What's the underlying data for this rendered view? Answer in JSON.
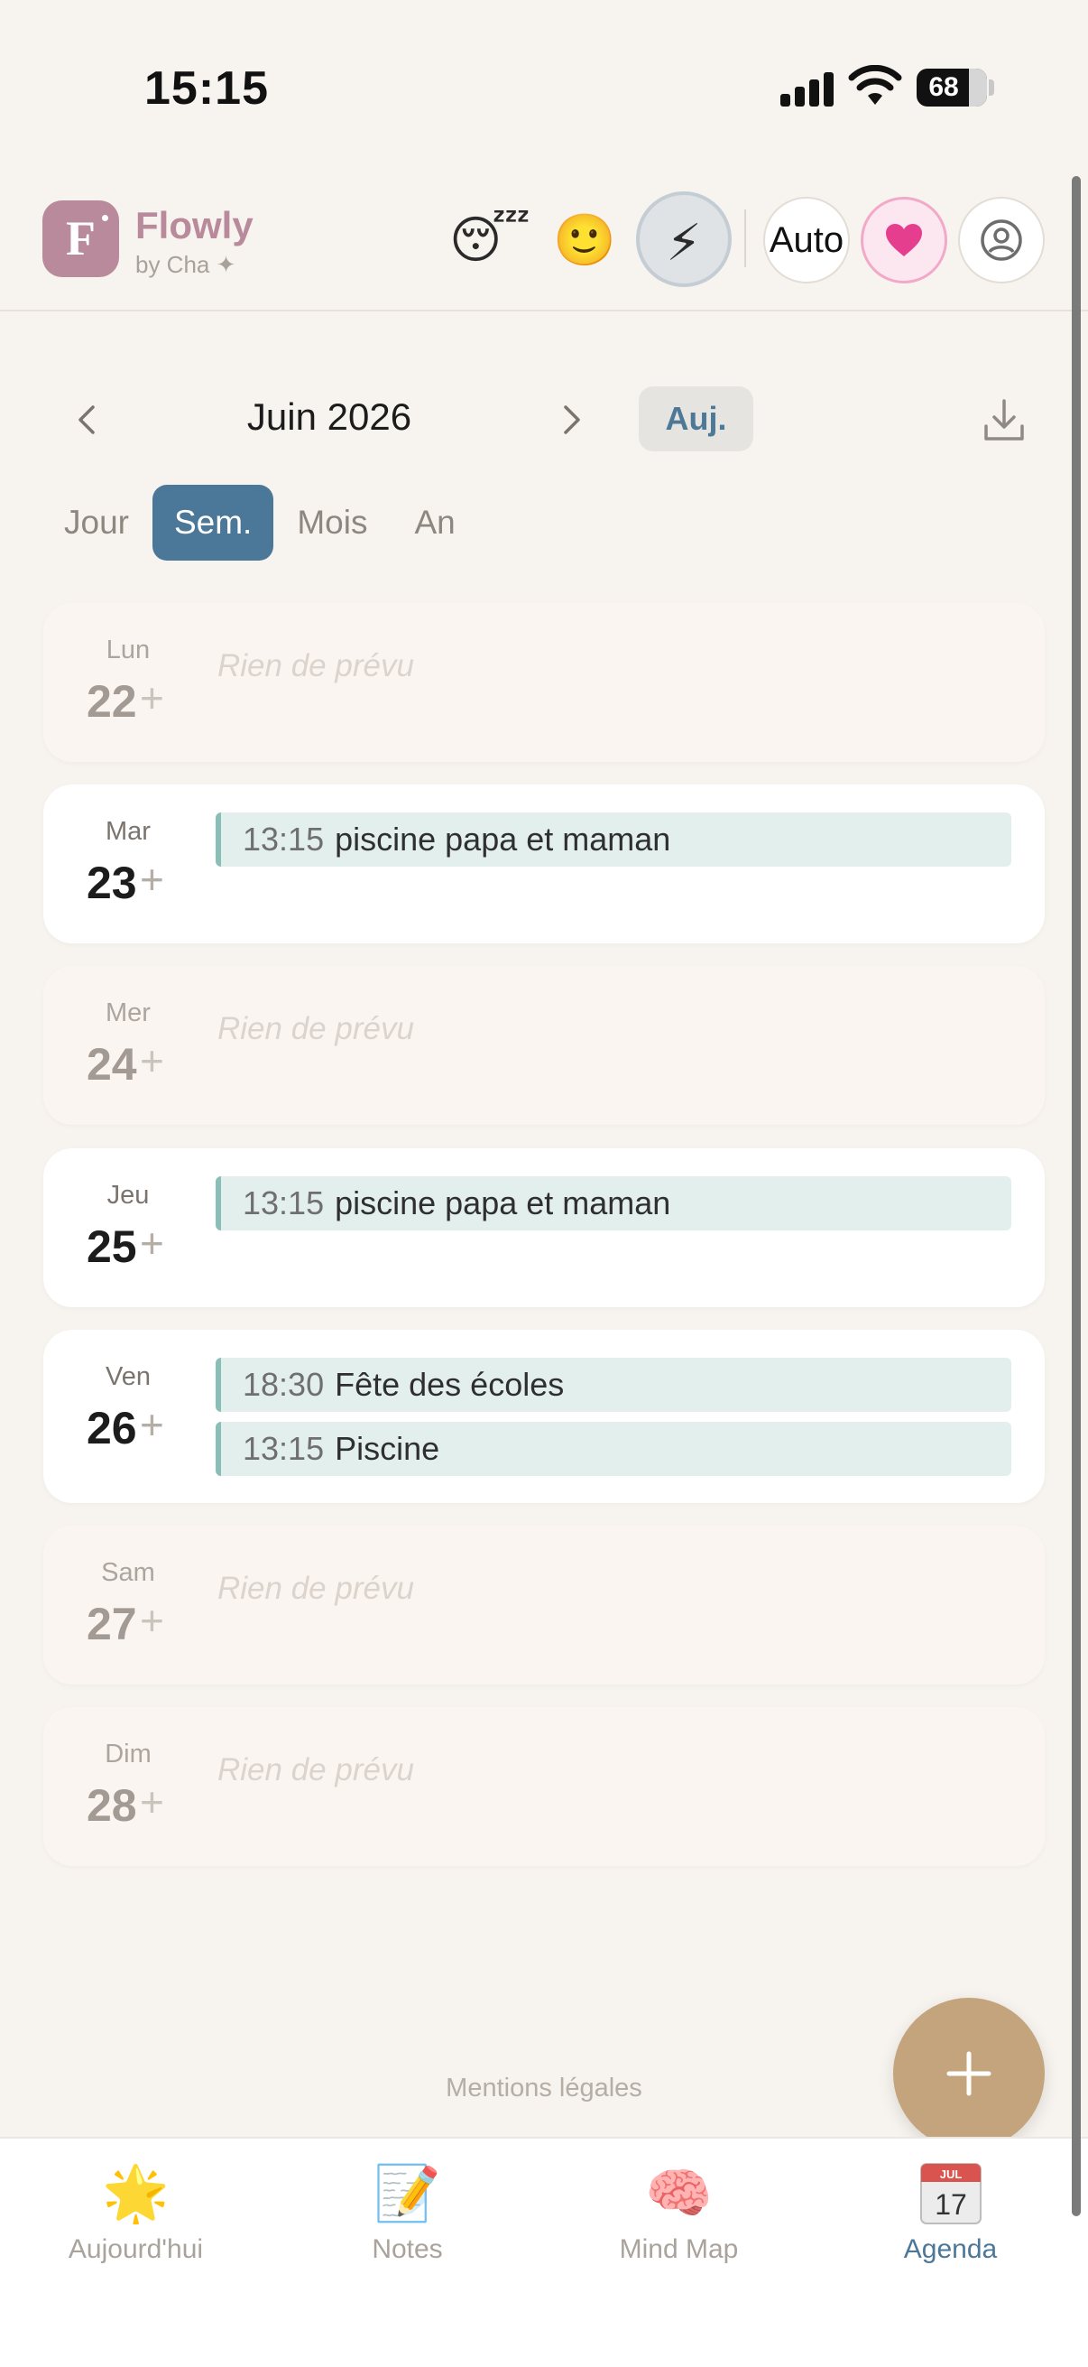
{
  "status_bar": {
    "time": "15:15",
    "battery": "68"
  },
  "header": {
    "logo_letter": "F",
    "brand_name": "Flowly",
    "brand_sub": "by Cha ✦",
    "moods": [
      "😴",
      "🙂",
      "⚡"
    ],
    "auto_label": "Auto",
    "heart_color": "#e63e8e"
  },
  "calendar": {
    "month_title": "Juin 2026",
    "today_label": "Auj.",
    "views": [
      "Jour",
      "Sem.",
      "Mois",
      "An"
    ],
    "active_view": "Sem.",
    "empty_text": "Rien de prévu",
    "add_symbol": "+",
    "days": [
      {
        "name": "Lun",
        "num": "22",
        "events": []
      },
      {
        "name": "Mar",
        "num": "23",
        "events": [
          {
            "time": "13:15",
            "title": "piscine papa et maman"
          }
        ]
      },
      {
        "name": "Mer",
        "num": "24",
        "events": []
      },
      {
        "name": "Jeu",
        "num": "25",
        "events": [
          {
            "time": "13:15",
            "title": "piscine papa et maman"
          }
        ]
      },
      {
        "name": "Ven",
        "num": "26",
        "events": [
          {
            "time": "18:30",
            "title": "Fête des écoles"
          },
          {
            "time": "13:15",
            "title": "Piscine"
          }
        ]
      },
      {
        "name": "Sam",
        "num": "27",
        "events": []
      },
      {
        "name": "Dim",
        "num": "28",
        "events": []
      }
    ]
  },
  "footer": {
    "legal": "Mentions légales"
  },
  "bottom_nav": {
    "items": [
      {
        "label": "Aujourd'hui",
        "glyph": "🌟",
        "icon": "star-icon"
      },
      {
        "label": "Notes",
        "glyph": "📝",
        "icon": "memo-icon"
      },
      {
        "label": "Mind Map",
        "glyph": "🧠",
        "icon": "brain-icon"
      },
      {
        "label": "Agenda",
        "glyph": "📅",
        "icon": "calendar-icon"
      }
    ],
    "active": "Agenda",
    "calendar_icon_month": "JUL",
    "calendar_icon_day": "17"
  },
  "colors": {
    "background": "#f7f3ee",
    "accent": "#4b7898",
    "brand": "#b88a9b",
    "event_bg": "#e3efed",
    "event_border": "#89bfb7",
    "fab": "#c4a47c"
  }
}
